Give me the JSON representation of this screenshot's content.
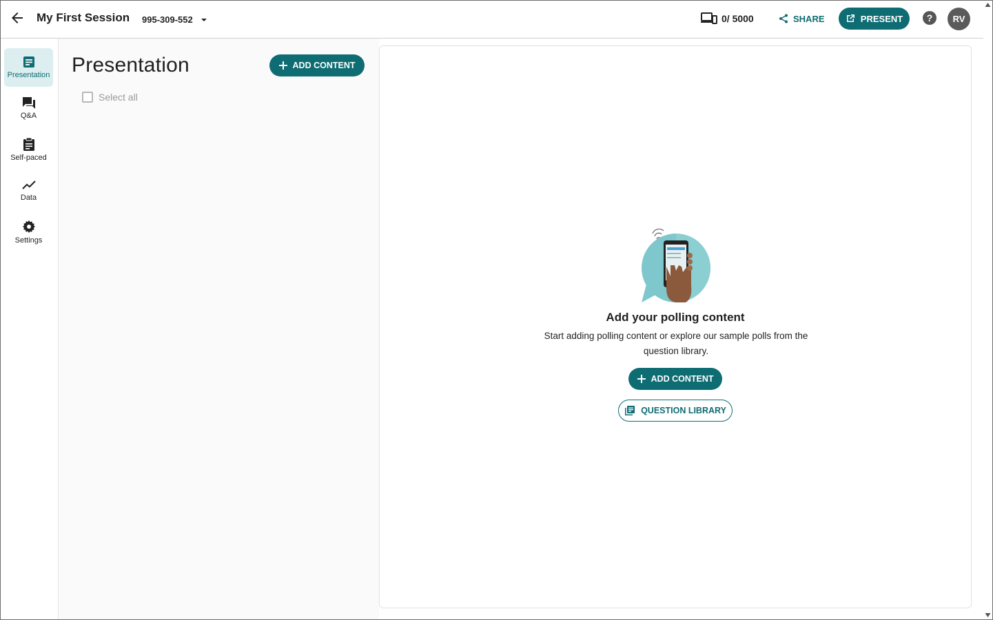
{
  "header": {
    "session_title": "My First Session",
    "session_code": "995-309-552",
    "participant_count": "0/ 5000",
    "share_label": "SHARE",
    "present_label": "PRESENT",
    "avatar_initials": "RV"
  },
  "sidebar": {
    "items": [
      {
        "label": "Presentation",
        "icon": "presentation-icon",
        "active": true
      },
      {
        "label": "Q&A",
        "icon": "qa-icon",
        "active": false
      },
      {
        "label": "Self-paced",
        "icon": "clipboard-icon",
        "active": false
      },
      {
        "label": "Data",
        "icon": "chart-line-icon",
        "active": false
      },
      {
        "label": "Settings",
        "icon": "gear-icon",
        "active": false
      }
    ]
  },
  "list_panel": {
    "title": "Presentation",
    "add_content_label": "ADD CONTENT",
    "select_all_label": "Select all"
  },
  "empty_state": {
    "title": "Add your polling content",
    "description": "Start adding polling content or explore our sample polls from the question library.",
    "add_content_label": "ADD CONTENT",
    "question_library_label": "QUESTION LIBRARY"
  },
  "colors": {
    "accent": "#0e6c73",
    "active_nav_bg": "#dceeef",
    "panel_bg": "#fafafa"
  }
}
